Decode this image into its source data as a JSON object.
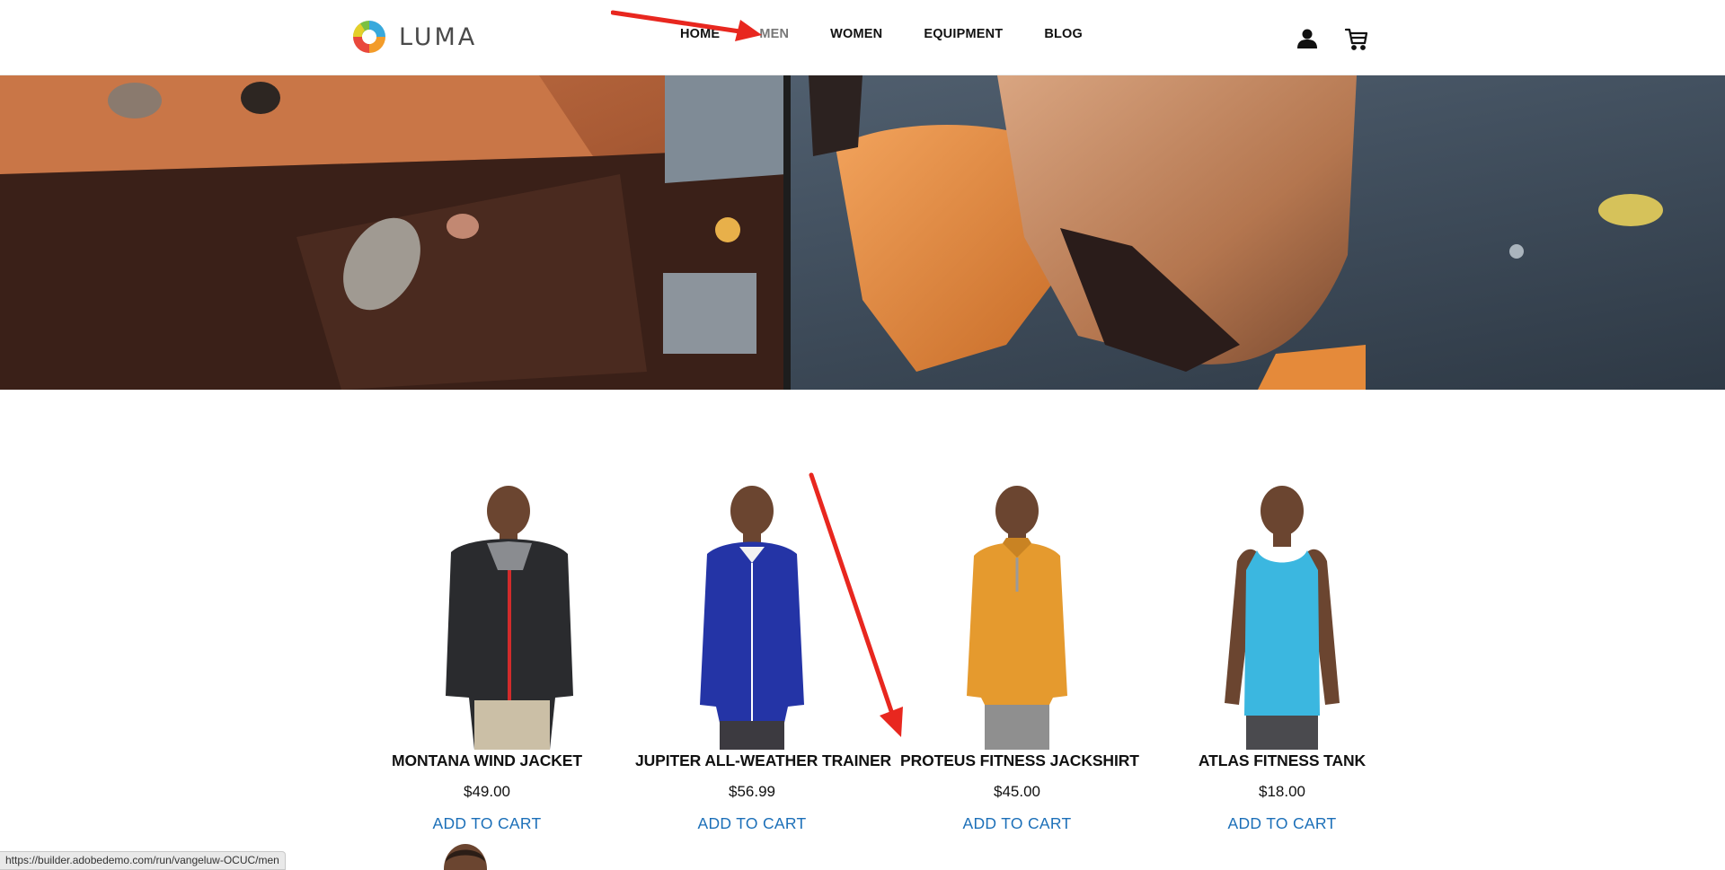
{
  "brand": {
    "name": "LUMA"
  },
  "nav": {
    "items": [
      {
        "label": "HOME",
        "active": false
      },
      {
        "label": "MEN",
        "active": true
      },
      {
        "label": "WOMEN",
        "active": false
      },
      {
        "label": "EQUIPMENT",
        "active": false
      },
      {
        "label": "BLOG",
        "active": false
      }
    ]
  },
  "header_icons": {
    "account": "user-icon",
    "cart": "cart-icon"
  },
  "hero": {
    "image": "rock-climber-on-climbing-wall"
  },
  "products": [
    {
      "name": "MONTANA WIND JACKET",
      "price": "$49.00",
      "cta": "ADD TO CART",
      "garment_color": "#2a2b2e",
      "accent_color": "#d22b2b"
    },
    {
      "name": "JUPITER ALL-WEATHER TRAINER",
      "price": "$56.99",
      "cta": "ADD TO CART",
      "garment_color": "#2434a6",
      "accent_color": "#ffffff"
    },
    {
      "name": "PROTEUS FITNESS JACKSHIRT",
      "price": "$45.00",
      "cta": "ADD TO CART",
      "garment_color": "#e59a2e",
      "accent_color": "#9a9a9a"
    },
    {
      "name": "ATLAS FITNESS TANK",
      "price": "$18.00",
      "cta": "ADD TO CART",
      "garment_color": "#3bb7e0",
      "accent_color": "#3bb7e0"
    }
  ],
  "status_bar": {
    "url": "https://builder.adobedemo.com/run/vangeluw-OCUC/men"
  },
  "colors": {
    "link": "#1b6fb8",
    "annotation_arrow": "#e8271f",
    "nav_active": "#777777"
  }
}
